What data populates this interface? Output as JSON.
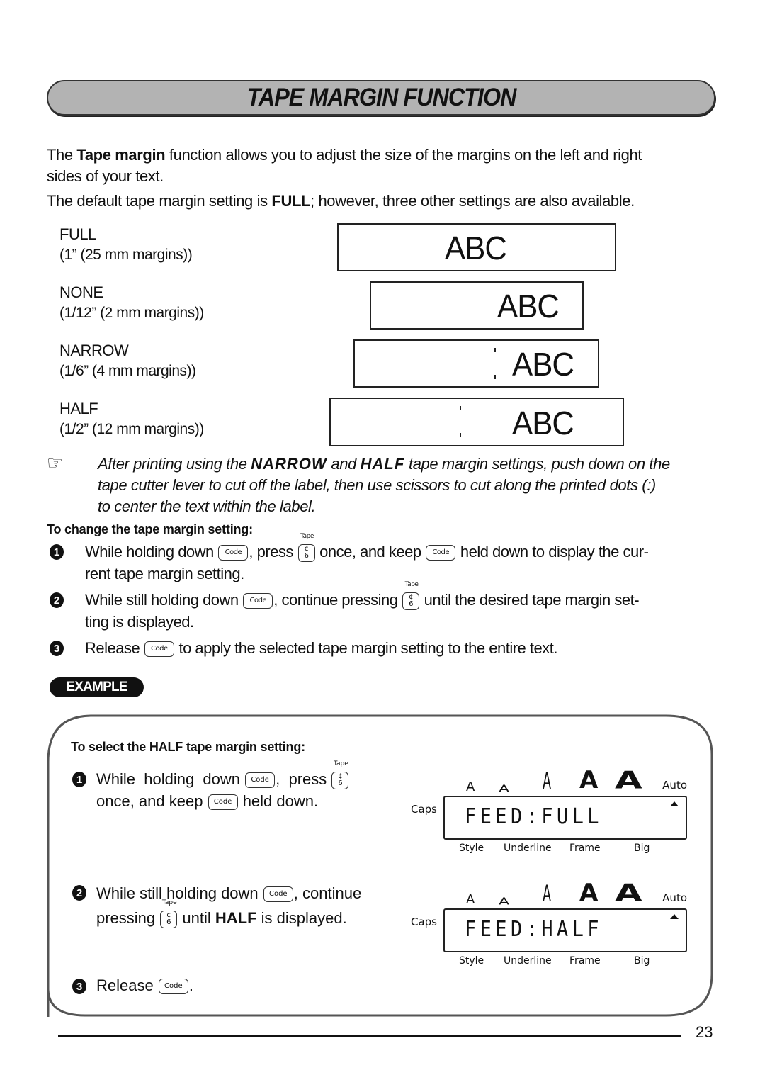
{
  "title": "TAPE MARGIN FUNCTION",
  "intro": {
    "p1_before": "The ",
    "p1_bold": "Tape margin",
    "p1_after_line1": " function allows you to adjust the size of the margins on the left and right",
    "p1_line2": "sides of your text.",
    "p2_before": "The default tape margin setting is ",
    "p2_bold": "FULL",
    "p2_after": "; however, three other settings are also available."
  },
  "settings": [
    {
      "name": "FULL",
      "desc": "(1” (25 mm margins))",
      "sample": "ABC"
    },
    {
      "name": "NONE",
      "desc": "(1/12” (2 mm margins))",
      "sample": "ABC"
    },
    {
      "name": "NARROW",
      "desc": "(1/6” (4 mm margins))",
      "sample": "ABC"
    },
    {
      "name": "HALF",
      "desc": "(1/2” (12 mm margins))",
      "sample": "ABC"
    }
  ],
  "note": {
    "icon": "pointing-hand-icon",
    "glyph": "☞",
    "l1_a": "After printing using the ",
    "l1_b": "NARROW",
    "l1_c": " and ",
    "l1_d": "HALF",
    "l1_e": " tape margin settings, push down on the",
    "l2": "tape cutter lever to cut off the label, then use scissors to cut along the printed dots (:)",
    "l3": "to center the text within the label."
  },
  "change_heading": "To change the tape margin setting:",
  "keys": {
    "code": "Code",
    "tape_top": "Tape",
    "tape_glyph_top": "¢",
    "tape_glyph_bottom": "6"
  },
  "steps": [
    {
      "num": "1",
      "a": "While holding down ",
      "b": ", press ",
      "c": " once, and keep ",
      "d": " held down to display the cur-",
      "l2": "rent tape margin setting."
    },
    {
      "num": "2",
      "a": "While still holding down ",
      "b": ", continue pressing ",
      "c": " until the desired tape margin set-",
      "l2": "ting is displayed."
    },
    {
      "num": "3",
      "a": "Release ",
      "b": " to apply the selected tape margin setting to the entire text."
    }
  ],
  "example": {
    "badge": "EXAMPLE",
    "heading": "To select the HALF tape margin setting:",
    "steps": [
      {
        "num": "1",
        "a": "While  holding  down ",
        "b": ",  press ",
        "l2a": "once, and keep ",
        "l2b": " held down."
      },
      {
        "num": "2",
        "a": "While still holding down ",
        "b": ", continue",
        "l2a": "pressing ",
        "l2b": " until ",
        "l2bold": "HALF",
        "l2c": " is displayed."
      },
      {
        "num": "3",
        "a": "Release ",
        "b": "."
      }
    ],
    "lcd": [
      {
        "text": "FEED:FULL",
        "caps": "Caps",
        "auto": "Auto",
        "labels": [
          "Style",
          "Underline",
          "Frame",
          "Big"
        ]
      },
      {
        "text": "FEED:HALF",
        "caps": "Caps",
        "auto": "Auto",
        "labels": [
          "Style",
          "Underline",
          "Frame",
          "Big"
        ]
      }
    ]
  },
  "page_number": "23"
}
